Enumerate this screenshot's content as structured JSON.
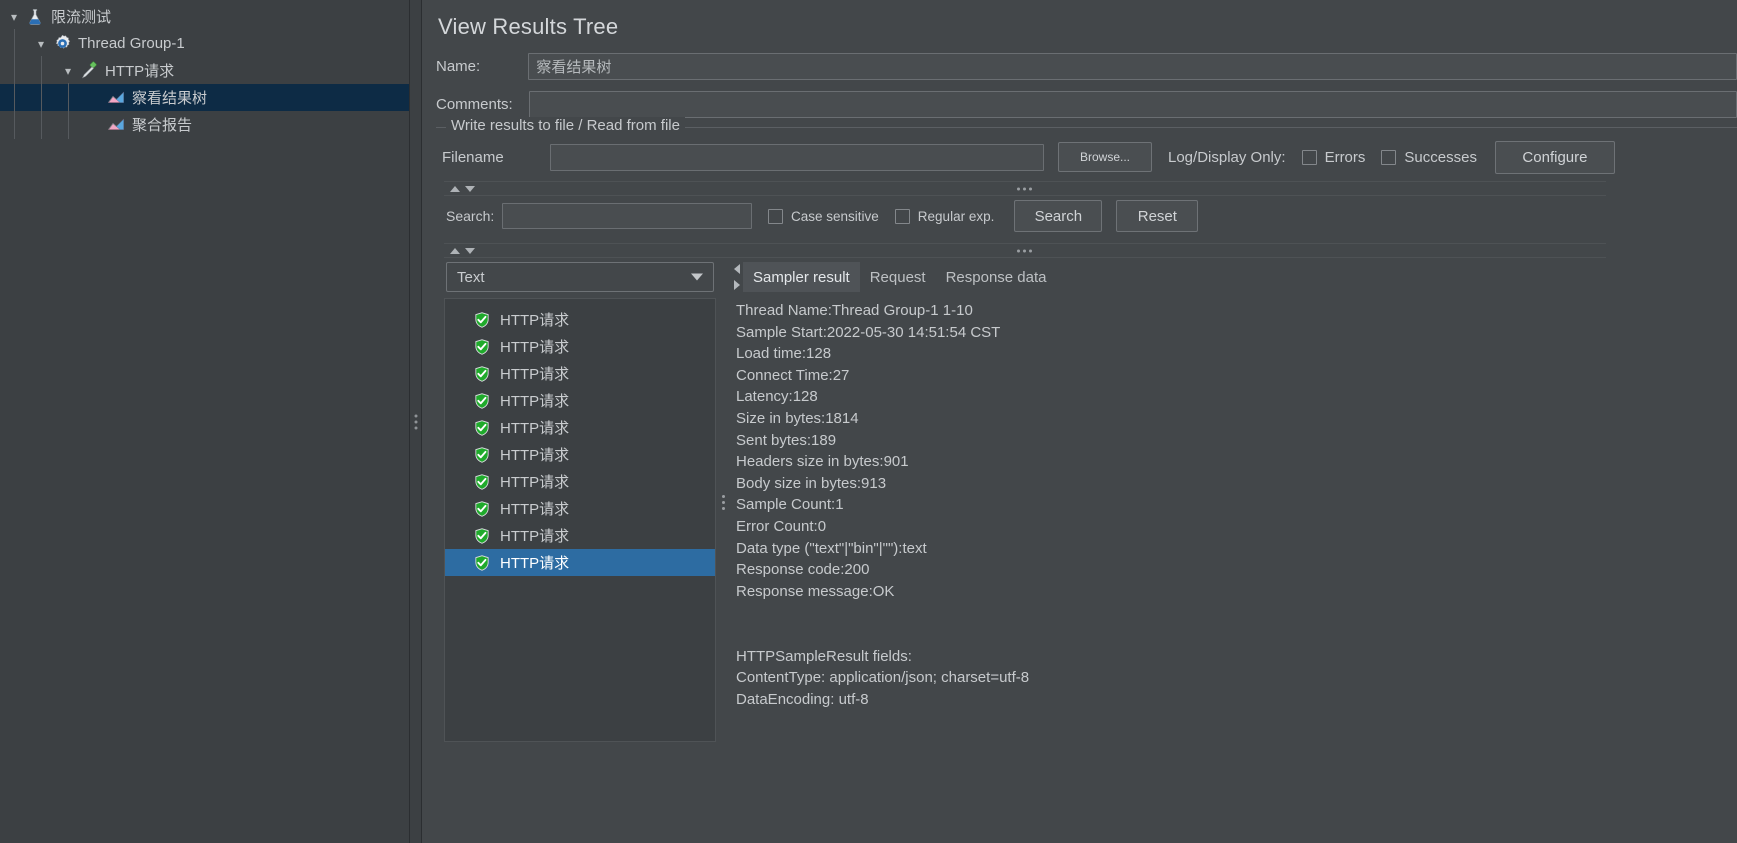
{
  "tree": {
    "items": [
      {
        "label": "限流测试",
        "depth": 0,
        "twisty": "down",
        "icon": "jmeter-flask-icon",
        "selected": false
      },
      {
        "label": "Thread Group-1",
        "depth": 1,
        "twisty": "down",
        "icon": "thread-group-icon",
        "selected": false
      },
      {
        "label": "HTTP请求",
        "depth": 2,
        "twisty": "down",
        "icon": "http-sampler-icon",
        "selected": false
      },
      {
        "label": "察看结果树",
        "depth": 3,
        "twisty": "none",
        "icon": "listener-chart-icon",
        "selected": true
      },
      {
        "label": "聚合报告",
        "depth": 3,
        "twisty": "none",
        "icon": "listener-chart-icon",
        "selected": false
      }
    ]
  },
  "page": {
    "title": "View Results Tree",
    "name_label": "Name:",
    "name_value": "察看结果树",
    "comments_label": "Comments:",
    "comments_value": ""
  },
  "write_results_group": {
    "title": "Write results to file / Read from file",
    "filename_label": "Filename",
    "filename_value": "",
    "browse_label": "Browse...",
    "log_display_label": "Log/Display Only:",
    "errors_label": "Errors",
    "errors_checked": false,
    "successes_label": "Successes",
    "successes_checked": false,
    "configure_label": "Configure"
  },
  "search": {
    "label": "Search:",
    "value": "",
    "case_sensitive_label": "Case sensitive",
    "case_sensitive_checked": false,
    "regular_exp_label": "Regular exp.",
    "regular_exp_checked": false,
    "search_button": "Search",
    "reset_button": "Reset"
  },
  "renderer": {
    "selected": "Text"
  },
  "results": {
    "items": [
      {
        "label": "HTTP请求",
        "status": "success",
        "selected": false
      },
      {
        "label": "HTTP请求",
        "status": "success",
        "selected": false
      },
      {
        "label": "HTTP请求",
        "status": "success",
        "selected": false
      },
      {
        "label": "HTTP请求",
        "status": "success",
        "selected": false
      },
      {
        "label": "HTTP请求",
        "status": "success",
        "selected": false
      },
      {
        "label": "HTTP请求",
        "status": "success",
        "selected": false
      },
      {
        "label": "HTTP请求",
        "status": "success",
        "selected": false
      },
      {
        "label": "HTTP请求",
        "status": "success",
        "selected": false
      },
      {
        "label": "HTTP请求",
        "status": "success",
        "selected": false
      },
      {
        "label": "HTTP请求",
        "status": "success",
        "selected": true
      }
    ]
  },
  "tabs": [
    {
      "label": "Sampler result",
      "active": true
    },
    {
      "label": "Request",
      "active": false
    },
    {
      "label": "Response data",
      "active": false
    }
  ],
  "sampler_result": {
    "lines": [
      "Thread Name:Thread Group-1 1-10",
      "Sample Start:2022-05-30 14:51:54 CST",
      "Load time:128",
      "Connect Time:27",
      "Latency:128",
      "Size in bytes:1814",
      "Sent bytes:189",
      "Headers size in bytes:901",
      "Body size in bytes:913",
      "Sample Count:1",
      "Error Count:0",
      "Data type (\"text\"|\"bin\"|\"\"):text",
      "Response code:200",
      "Response message:OK",
      "",
      "",
      "HTTPSampleResult fields:",
      "ContentType: application/json; charset=utf-8",
      "DataEncoding: utf-8"
    ]
  },
  "colors": {
    "window_bg": "#3c4043",
    "panel_bg": "#43474a",
    "tree_selection": "#0d2b45",
    "list_selection": "#2d6ca2",
    "text": "#c7cacd",
    "success_green": "#22a12a"
  }
}
